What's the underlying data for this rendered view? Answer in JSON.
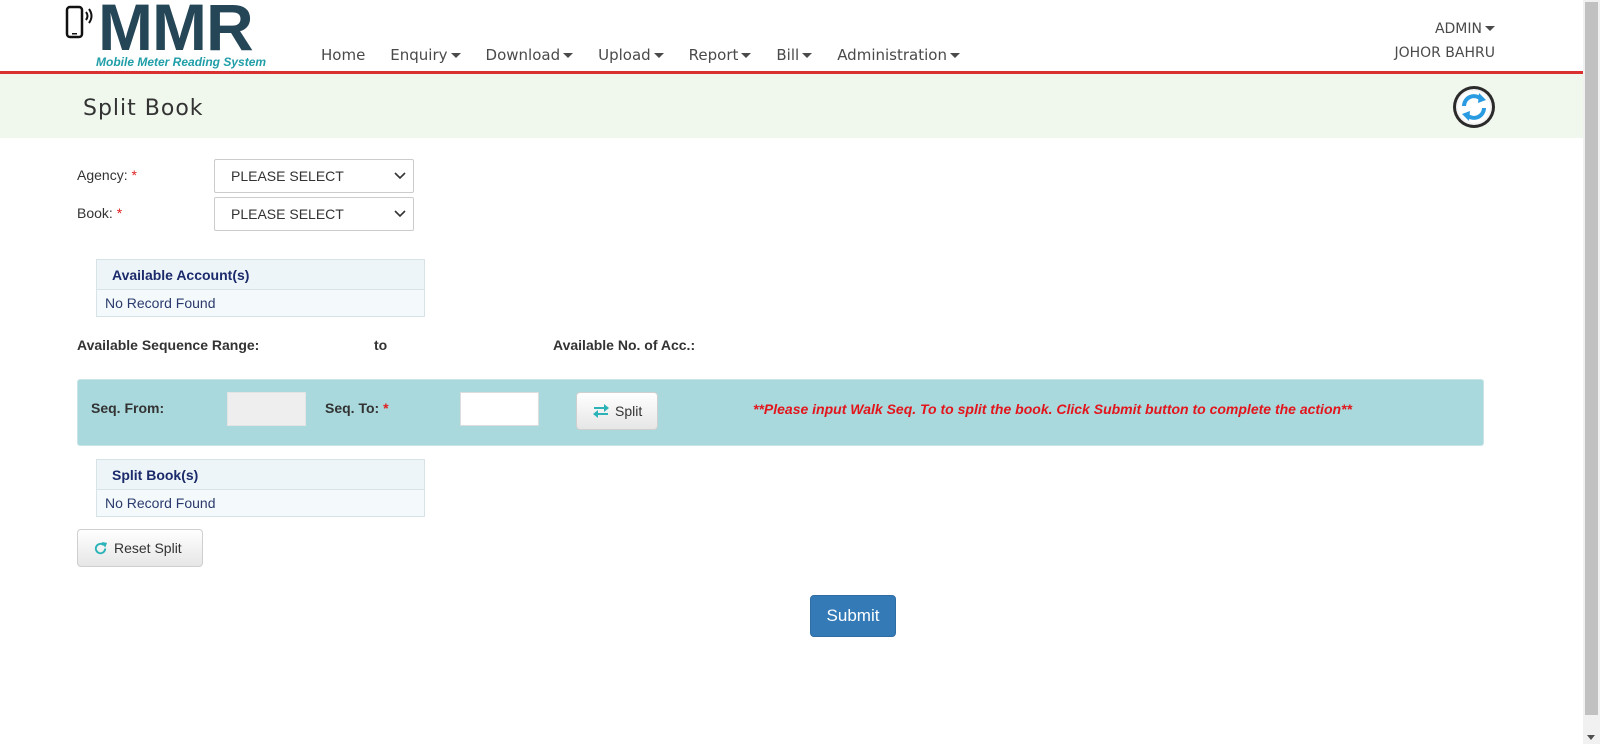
{
  "app": {
    "logo_text": "MMR",
    "logo_subtitle": "Mobile Meter Reading System"
  },
  "nav": {
    "items": [
      {
        "label": "Home",
        "dropdown": false
      },
      {
        "label": "Enquiry",
        "dropdown": true
      },
      {
        "label": "Download",
        "dropdown": true
      },
      {
        "label": "Upload",
        "dropdown": true
      },
      {
        "label": "Report",
        "dropdown": true
      },
      {
        "label": "Bill",
        "dropdown": true
      },
      {
        "label": "Administration",
        "dropdown": true
      }
    ]
  },
  "user": {
    "name": "ADMIN",
    "location": "JOHOR BAHRU"
  },
  "page": {
    "title": "Split Book"
  },
  "form": {
    "agency_label": "Agency:",
    "agency_value": "PLEASE SELECT",
    "book_label": "Book:",
    "book_value": "PLEASE SELECT",
    "required_mark": "*"
  },
  "available_accounts": {
    "header": "Available Account(s)",
    "empty_text": "No Record Found"
  },
  "range": {
    "sequence_label": "Available Sequence Range:",
    "to_label": "to",
    "count_label": "Available No. of Acc.:"
  },
  "seq_panel": {
    "from_label": "Seq. From:",
    "to_label": "Seq. To:",
    "from_value": "",
    "to_value": "",
    "split_label": "Split",
    "warning": "**Please input Walk Seq. To to split the book. Click Submit button to complete the action**"
  },
  "split_books": {
    "header": "Split Book(s)",
    "empty_text": "No Record Found"
  },
  "actions": {
    "reset_label": "Reset Split",
    "submit_label": "Submit"
  },
  "colors": {
    "brand_dark": "#254657",
    "brand_teal": "#1f9ea8",
    "header_rule": "#d9312f",
    "title_bar_bg": "#f0f8ee",
    "seq_panel_bg": "#a9d9dc",
    "warning_text": "#e3151c",
    "submit_bg": "#337ab7"
  }
}
